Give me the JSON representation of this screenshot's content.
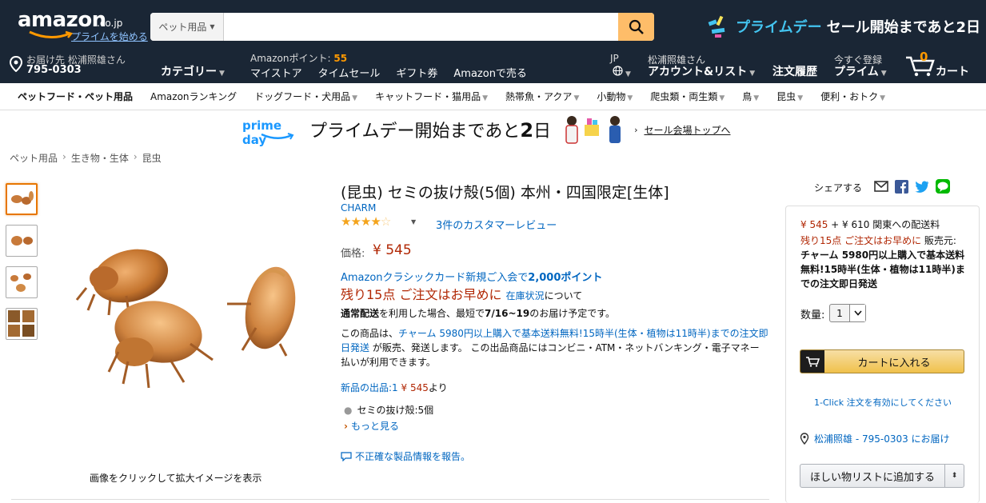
{
  "header": {
    "logo": "amazon",
    "logo_domain": ".co.jp",
    "prime_start": "プライムを始める",
    "search": {
      "category": "ペット用品",
      "value": "",
      "placeholder": ""
    },
    "promo_name": "プライムデー",
    "promo_rest": "セール開始まであと2日",
    "deliver_line1": "お届け先 松浦照雄さん",
    "deliver_line2": "795-0303",
    "category": "カテゴリー",
    "points_prefix": "Amazonポイント:",
    "points_value": "55",
    "links": [
      "マイストア",
      "タイムセール",
      "ギフト券",
      "Amazonで売る"
    ],
    "lang": "JP",
    "account_line1": "松浦照雄さん",
    "account_line2": "アカウント&リスト",
    "orders": "注文履歴",
    "prime_line1": "今すぐ登録",
    "prime_line2": "プライム",
    "cart_count": "0",
    "cart_label": "カート"
  },
  "subnav": [
    "ペットフード・ペット用品",
    "Amazonランキング",
    "ドッグフード・犬用品",
    "キャットフード・猫用品",
    "熱帯魚・アクア",
    "小動物",
    "爬虫類・両生類",
    "鳥",
    "昆虫",
    "便利・おトク"
  ],
  "banner": {
    "logo": "prime day",
    "countdown_pre": "プライムデー開始まであと",
    "countdown_num": "2",
    "countdown_post": "日",
    "sale_link": "セール会場トップへ"
  },
  "breadcrumb": [
    "ペット用品",
    "生き物・生体",
    "昆虫"
  ],
  "image_caption": "画像をクリックして拡大イメージを表示",
  "product": {
    "title": "(昆虫) セミの抜け殻(5個) 本州・四国限定[生体]",
    "brand": "CHARM",
    "rating": 4,
    "review_link": "3件のカスタマーレビュー",
    "price_label": "価格:",
    "price": "¥ 545",
    "card_promo_pre": "Amazonクラシックカード新規ご入会で",
    "card_promo_pts": "2,000ポイント",
    "stock": "残り15点 ご注文はお早めに",
    "stock_link": "在庫状況",
    "stock_suffix": "について",
    "delivery_pre": "通常配送",
    "delivery_mid": "を利用した場合、最短で",
    "delivery_date": "7/16~19",
    "delivery_post": "のお届け予定です。",
    "seller_pre": "この商品は、",
    "seller_link": "チャーム 5980円以上購入で基本送料無料!15時半(生体・植物は11時半)までの注文即日発送",
    "seller_post": " が販売、発送します。 この出品商品にはコンビニ・ATM・ネットバンキング・電子マネー払いが利用できます。",
    "new_offers_pre": "新品の出品:1",
    "new_offers_price": "¥ 545",
    "new_offers_post": "より",
    "bullet": "セミの抜け殻:5個",
    "more": "もっと見る",
    "report": "不正確な製品情報を報告。"
  },
  "share": {
    "label": "シェアする"
  },
  "buybox": {
    "price": "¥ 545",
    "shipping": " + ¥ 610 関東への配送料",
    "stock": "残り15点 ご注文はお早めに",
    "seller_pre": " 販売元: ",
    "seller_bold": "チャーム 5980円以上購入で基本送料無料!15時半(生体・植物は11時半)までの注文即日発送",
    "qty_label": "数量:",
    "qty_value": "1",
    "add_to_cart": "カートに入れる",
    "oneclick": "1-Click 注文を有効にしてください",
    "deliver_to": "松浦照雄 - 795-0303 にお届け",
    "wishlist": "ほしい物リストに追加する"
  },
  "colors": {
    "nav_bg": "#1a2635",
    "price": "#b12704",
    "link": "#0066c0",
    "accent": "#ff9900",
    "cart_button": "#f0c14b"
  }
}
